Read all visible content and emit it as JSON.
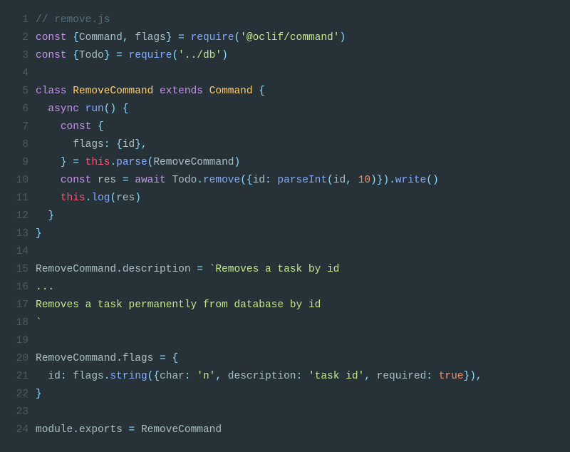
{
  "colors": {
    "background": "#263238",
    "lineno": "#4a5a63",
    "comment": "#546e7a",
    "keyword": "#c792ea",
    "function": "#82aaff",
    "class": "#ffcb6b",
    "string": "#c3e88d",
    "number": "#f78c6c",
    "operator": "#89ddff",
    "plain": "#aabfc7",
    "this": "#ff5370"
  },
  "lines": [
    {
      "n": "1",
      "tokens": [
        {
          "c": "c-comment",
          "t": "// remove.js"
        }
      ]
    },
    {
      "n": "2",
      "tokens": [
        {
          "c": "c-keyword",
          "t": "const"
        },
        {
          "c": "c-plain",
          "t": " "
        },
        {
          "c": "c-punct",
          "t": "{"
        },
        {
          "c": "c-plain",
          "t": "Command"
        },
        {
          "c": "c-punct",
          "t": ","
        },
        {
          "c": "c-plain",
          "t": " flags"
        },
        {
          "c": "c-punct",
          "t": "}"
        },
        {
          "c": "c-plain",
          "t": " "
        },
        {
          "c": "c-operator",
          "t": "="
        },
        {
          "c": "c-plain",
          "t": " "
        },
        {
          "c": "c-func",
          "t": "require"
        },
        {
          "c": "c-punct",
          "t": "("
        },
        {
          "c": "c-string",
          "t": "'@oclif/command'"
        },
        {
          "c": "c-punct",
          "t": ")"
        }
      ]
    },
    {
      "n": "3",
      "tokens": [
        {
          "c": "c-keyword",
          "t": "const"
        },
        {
          "c": "c-plain",
          "t": " "
        },
        {
          "c": "c-punct",
          "t": "{"
        },
        {
          "c": "c-plain",
          "t": "Todo"
        },
        {
          "c": "c-punct",
          "t": "}"
        },
        {
          "c": "c-plain",
          "t": " "
        },
        {
          "c": "c-operator",
          "t": "="
        },
        {
          "c": "c-plain",
          "t": " "
        },
        {
          "c": "c-func",
          "t": "require"
        },
        {
          "c": "c-punct",
          "t": "("
        },
        {
          "c": "c-string",
          "t": "'../db'"
        },
        {
          "c": "c-punct",
          "t": ")"
        }
      ]
    },
    {
      "n": "4",
      "tokens": [
        {
          "c": "c-plain",
          "t": ""
        }
      ]
    },
    {
      "n": "5",
      "tokens": [
        {
          "c": "c-keyword",
          "t": "class"
        },
        {
          "c": "c-plain",
          "t": " "
        },
        {
          "c": "c-class",
          "t": "RemoveCommand"
        },
        {
          "c": "c-plain",
          "t": " "
        },
        {
          "c": "c-keyword",
          "t": "extends"
        },
        {
          "c": "c-plain",
          "t": " "
        },
        {
          "c": "c-class",
          "t": "Command"
        },
        {
          "c": "c-plain",
          "t": " "
        },
        {
          "c": "c-punct",
          "t": "{"
        }
      ]
    },
    {
      "n": "6",
      "tokens": [
        {
          "c": "c-plain",
          "t": "  "
        },
        {
          "c": "c-keyword",
          "t": "async"
        },
        {
          "c": "c-plain",
          "t": " "
        },
        {
          "c": "c-func",
          "t": "run"
        },
        {
          "c": "c-punct",
          "t": "()"
        },
        {
          "c": "c-plain",
          "t": " "
        },
        {
          "c": "c-punct",
          "t": "{"
        }
      ]
    },
    {
      "n": "7",
      "tokens": [
        {
          "c": "c-plain",
          "t": "    "
        },
        {
          "c": "c-keyword",
          "t": "const"
        },
        {
          "c": "c-plain",
          "t": " "
        },
        {
          "c": "c-punct",
          "t": "{"
        }
      ]
    },
    {
      "n": "8",
      "tokens": [
        {
          "c": "c-plain",
          "t": "      flags"
        },
        {
          "c": "c-punct",
          "t": ":"
        },
        {
          "c": "c-plain",
          "t": " "
        },
        {
          "c": "c-punct",
          "t": "{"
        },
        {
          "c": "c-plain",
          "t": "id"
        },
        {
          "c": "c-punct",
          "t": "},"
        }
      ]
    },
    {
      "n": "9",
      "tokens": [
        {
          "c": "c-plain",
          "t": "    "
        },
        {
          "c": "c-punct",
          "t": "}"
        },
        {
          "c": "c-plain",
          "t": " "
        },
        {
          "c": "c-operator",
          "t": "="
        },
        {
          "c": "c-plain",
          "t": " "
        },
        {
          "c": "c-this",
          "t": "this"
        },
        {
          "c": "c-punct",
          "t": "."
        },
        {
          "c": "c-func",
          "t": "parse"
        },
        {
          "c": "c-punct",
          "t": "("
        },
        {
          "c": "c-plain",
          "t": "RemoveCommand"
        },
        {
          "c": "c-punct",
          "t": ")"
        }
      ]
    },
    {
      "n": "10",
      "tokens": [
        {
          "c": "c-plain",
          "t": "    "
        },
        {
          "c": "c-keyword",
          "t": "const"
        },
        {
          "c": "c-plain",
          "t": " res "
        },
        {
          "c": "c-operator",
          "t": "="
        },
        {
          "c": "c-plain",
          "t": " "
        },
        {
          "c": "c-keyword",
          "t": "await"
        },
        {
          "c": "c-plain",
          "t": " Todo"
        },
        {
          "c": "c-punct",
          "t": "."
        },
        {
          "c": "c-func",
          "t": "remove"
        },
        {
          "c": "c-punct",
          "t": "({"
        },
        {
          "c": "c-plain",
          "t": "id"
        },
        {
          "c": "c-punct",
          "t": ":"
        },
        {
          "c": "c-plain",
          "t": " "
        },
        {
          "c": "c-func",
          "t": "parseInt"
        },
        {
          "c": "c-punct",
          "t": "("
        },
        {
          "c": "c-plain",
          "t": "id"
        },
        {
          "c": "c-punct",
          "t": ","
        },
        {
          "c": "c-plain",
          "t": " "
        },
        {
          "c": "c-number",
          "t": "10"
        },
        {
          "c": "c-punct",
          "t": ")})."
        },
        {
          "c": "c-func",
          "t": "write"
        },
        {
          "c": "c-punct",
          "t": "()"
        }
      ]
    },
    {
      "n": "11",
      "tokens": [
        {
          "c": "c-plain",
          "t": "    "
        },
        {
          "c": "c-this",
          "t": "this"
        },
        {
          "c": "c-punct",
          "t": "."
        },
        {
          "c": "c-func",
          "t": "log"
        },
        {
          "c": "c-punct",
          "t": "("
        },
        {
          "c": "c-plain",
          "t": "res"
        },
        {
          "c": "c-punct",
          "t": ")"
        }
      ]
    },
    {
      "n": "12",
      "tokens": [
        {
          "c": "c-plain",
          "t": "  "
        },
        {
          "c": "c-punct",
          "t": "}"
        }
      ]
    },
    {
      "n": "13",
      "tokens": [
        {
          "c": "c-punct",
          "t": "}"
        }
      ]
    },
    {
      "n": "14",
      "tokens": [
        {
          "c": "c-plain",
          "t": ""
        }
      ]
    },
    {
      "n": "15",
      "tokens": [
        {
          "c": "c-plain",
          "t": "RemoveCommand"
        },
        {
          "c": "c-punct",
          "t": "."
        },
        {
          "c": "c-prop",
          "t": "description"
        },
        {
          "c": "c-plain",
          "t": " "
        },
        {
          "c": "c-operator",
          "t": "="
        },
        {
          "c": "c-plain",
          "t": " "
        },
        {
          "c": "c-string",
          "t": "`Removes a task by id"
        }
      ]
    },
    {
      "n": "16",
      "tokens": [
        {
          "c": "c-string",
          "t": "..."
        }
      ]
    },
    {
      "n": "17",
      "tokens": [
        {
          "c": "c-string",
          "t": "Removes a task permanently from database by id"
        }
      ]
    },
    {
      "n": "18",
      "tokens": [
        {
          "c": "c-string",
          "t": "`"
        }
      ]
    },
    {
      "n": "19",
      "tokens": [
        {
          "c": "c-plain",
          "t": ""
        }
      ]
    },
    {
      "n": "20",
      "tokens": [
        {
          "c": "c-plain",
          "t": "RemoveCommand"
        },
        {
          "c": "c-punct",
          "t": "."
        },
        {
          "c": "c-prop",
          "t": "flags"
        },
        {
          "c": "c-plain",
          "t": " "
        },
        {
          "c": "c-operator",
          "t": "="
        },
        {
          "c": "c-plain",
          "t": " "
        },
        {
          "c": "c-punct",
          "t": "{"
        }
      ]
    },
    {
      "n": "21",
      "tokens": [
        {
          "c": "c-plain",
          "t": "  id"
        },
        {
          "c": "c-punct",
          "t": ":"
        },
        {
          "c": "c-plain",
          "t": " flags"
        },
        {
          "c": "c-punct",
          "t": "."
        },
        {
          "c": "c-func",
          "t": "string"
        },
        {
          "c": "c-punct",
          "t": "({"
        },
        {
          "c": "c-plain",
          "t": "char"
        },
        {
          "c": "c-punct",
          "t": ":"
        },
        {
          "c": "c-plain",
          "t": " "
        },
        {
          "c": "c-string",
          "t": "'n'"
        },
        {
          "c": "c-punct",
          "t": ","
        },
        {
          "c": "c-plain",
          "t": " description"
        },
        {
          "c": "c-punct",
          "t": ":"
        },
        {
          "c": "c-plain",
          "t": " "
        },
        {
          "c": "c-string",
          "t": "'task id'"
        },
        {
          "c": "c-punct",
          "t": ","
        },
        {
          "c": "c-plain",
          "t": " required"
        },
        {
          "c": "c-punct",
          "t": ":"
        },
        {
          "c": "c-plain",
          "t": " "
        },
        {
          "c": "c-bool",
          "t": "true"
        },
        {
          "c": "c-punct",
          "t": "}),"
        }
      ]
    },
    {
      "n": "22",
      "tokens": [
        {
          "c": "c-punct",
          "t": "}"
        }
      ]
    },
    {
      "n": "23",
      "tokens": [
        {
          "c": "c-plain",
          "t": ""
        }
      ]
    },
    {
      "n": "24",
      "tokens": [
        {
          "c": "c-plain",
          "t": "module"
        },
        {
          "c": "c-punct",
          "t": "."
        },
        {
          "c": "c-prop",
          "t": "exports"
        },
        {
          "c": "c-plain",
          "t": " "
        },
        {
          "c": "c-operator",
          "t": "="
        },
        {
          "c": "c-plain",
          "t": " RemoveCommand"
        }
      ]
    }
  ]
}
